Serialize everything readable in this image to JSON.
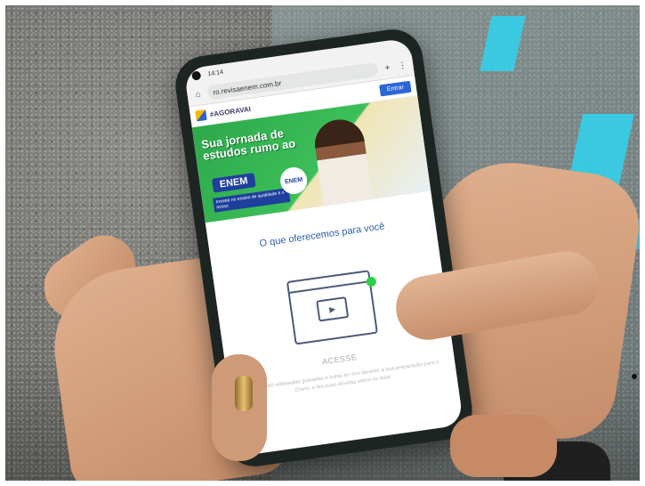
{
  "phone": {
    "status_time": "14:14",
    "url": "ro.revisaenem.com.br",
    "site_tag": "#AGORAVAI",
    "enter_button": "Entrar"
  },
  "banner": {
    "headline": "Sua jornada de estudos rumo ao",
    "exam": "ENEM",
    "subline": "Investir no ensino de qualidade é o nosso",
    "badge": "ENEM"
  },
  "page": {
    "section_title": "O que oferecemos para você",
    "card_title": "ACESSE",
    "card_text": "Mais de 300 videoaulas gravadas e aulas ao vivo durante a sua preparação para o Enem, e tire suas dúvidas sobre os mais"
  },
  "colors": {
    "brand_blue": "#2a66d6",
    "banner_green": "#3cbf5a",
    "accent_green": "#2bd04a",
    "floor_cyan": "#2fd3f0"
  }
}
